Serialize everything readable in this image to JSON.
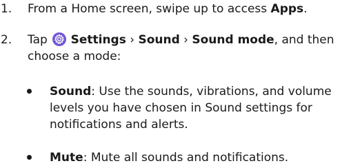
{
  "steps": [
    {
      "number": "1.",
      "text_before": "From a Home screen, swipe up to access ",
      "bold": "Apps",
      "text_after": "."
    },
    {
      "number": "2.",
      "line1_prefix": "Tap ",
      "icon": "settings-gear-icon",
      "path_settings": "Settings",
      "sep": " › ",
      "path_sound": "Sound",
      "path_mode": "Sound mode",
      "line1_suffix": ", and then",
      "line2": "choose a mode:"
    }
  ],
  "bullets": [
    {
      "term": "Sound",
      "line1_rest": ": Use the sounds, vibrations, and volume",
      "line2": "levels you have chosen in Sound settings for",
      "line3": "notifications and alerts."
    },
    {
      "term": "Mute",
      "line1_rest": ": Mute all sounds and notifications."
    }
  ],
  "colors": {
    "text": "#1a1a1a",
    "icon_bg": "#7457d6"
  }
}
